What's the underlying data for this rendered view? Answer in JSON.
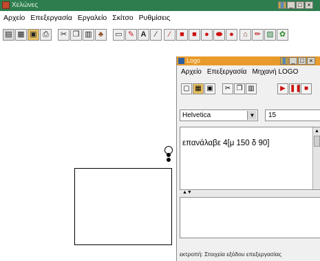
{
  "main_window": {
    "title": "Χελώνες",
    "menu": [
      "Αρχείο",
      "Επεξεργασία",
      "Εργαλείο",
      "Σκίτσο",
      "Ρυθμίσεις"
    ],
    "toolbar_icons": [
      "new-icon",
      "open-icon",
      "save-icon",
      "print-icon",
      "cut-icon",
      "copy-icon",
      "paste-icon",
      "turtle-icon",
      "rectangle-tool-icon",
      "pen-tool-icon",
      "text-tool-icon",
      "eraser-icon",
      "line-tool-icon",
      "filled-rect-icon",
      "color-red-icon",
      "circle-red-icon",
      "oval-red-icon",
      "circle-red2-icon",
      "house-icon",
      "pencil-icon",
      "image-icon",
      "turtle-green-icon"
    ],
    "text_tool_glyph": "A"
  },
  "logo_window": {
    "title": "Logo",
    "menu": [
      "Αρχείο",
      "Επεξεργασία",
      "Μηχανή LOGO"
    ],
    "toolbar_icons": [
      "new-icon",
      "open-icon",
      "save-icon",
      "cut-icon",
      "copy-icon",
      "paste-icon",
      "play-icon",
      "pause-icon",
      "stop-icon"
    ],
    "font": "Helvetica",
    "font_size": "15",
    "code": "επανάλαβε 4[μ 150 δ 90]",
    "status": "εκτροπή: Στοιχεία εξόδου επεξεργασίας"
  },
  "colors": {
    "main_titlebar": "#2e7d4e",
    "logo_titlebar": "#e89a2a",
    "accent_red": "#cc1010"
  }
}
